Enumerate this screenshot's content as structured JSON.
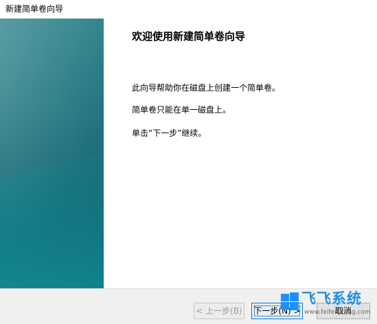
{
  "window": {
    "title": "新建简单卷向导"
  },
  "wizard": {
    "heading": "欢迎使用新建简单卷向导",
    "paragraphs": [
      "此向导帮助你在磁盘上创建一个简单卷。",
      "简单卷只能在单一磁盘上。",
      "单击“下一步”继续。"
    ]
  },
  "buttons": {
    "back": "< 上一步(B)",
    "next": "下一步(N) >",
    "cancel": "取消"
  },
  "watermark": {
    "site_name": "飞飞系统",
    "site_url": "www.feifeixitong.com"
  },
  "colors": {
    "banner_teal": "#1f6f7b",
    "accent_blue": "#0078d7",
    "footer_bg": "#f0f0f0"
  }
}
